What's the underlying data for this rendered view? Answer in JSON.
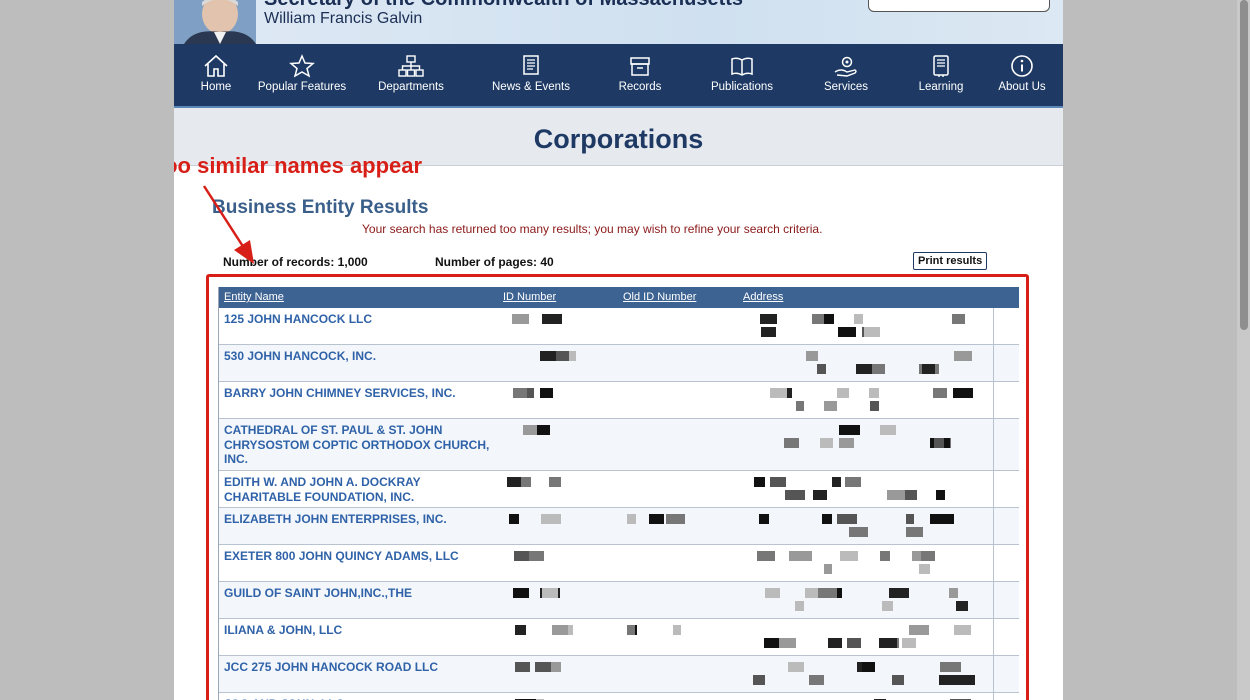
{
  "header": {
    "title": "Secretary of the Commonwealth of Massachusetts",
    "subtitle": "William Francis Galvin"
  },
  "nav": [
    {
      "label": "Home",
      "icon": "home-icon"
    },
    {
      "label": "Popular Features",
      "icon": "star-icon"
    },
    {
      "label": "Departments",
      "icon": "org-chart-icon"
    },
    {
      "label": "News & Events",
      "icon": "newspaper-icon"
    },
    {
      "label": "Records",
      "icon": "archive-box-icon"
    },
    {
      "label": "Publications",
      "icon": "book-icon"
    },
    {
      "label": "Services",
      "icon": "hand-gear-icon"
    },
    {
      "label": "Learning",
      "icon": "notebook-icon"
    },
    {
      "label": "About Us",
      "icon": "info-icon"
    }
  ],
  "page_title": "Corporations",
  "annotation": "Not too similar names appear",
  "results": {
    "heading": "Business Entity Results",
    "warning": "Your search has returned too many results; you may wish to refine your search criteria.",
    "records_label": "Number of records: 1,000",
    "pages_label": "Number of pages: 40",
    "print_label": "Print results"
  },
  "table": {
    "columns": [
      "Entity Name",
      "ID Number",
      "Old ID Number",
      "Address"
    ],
    "rows": [
      "125 JOHN HANCOCK LLC",
      "530 JOHN HANCOCK, INC.",
      "BARRY JOHN CHIMNEY SERVICES, INC.",
      "CATHEDRAL OF ST. PAUL & ST. JOHN CHRYSOSTOM COPTIC ORTHODOX CHURCH, INC.",
      "EDITH W. AND JOHN A. DOCKRAY CHARITABLE FOUNDATION, INC.",
      "ELIZABETH JOHN ENTERPRISES, INC.",
      "EXETER 800 JOHN QUINCY ADAMS, LLC",
      "GUILD OF SAINT JOHN,INC.,THE",
      "ILIANA & JOHN, LLC",
      "JCC 275 JOHN HANCOCK ROAD LLC",
      "JOC AND JOHN, LLC"
    ]
  },
  "colors": {
    "nav_bg": "#1e3a64",
    "table_header_bg": "#3d6392",
    "entity_link": "#2f62a8",
    "annotation_red": "#d81f17",
    "warning_text": "#8b1a1a"
  }
}
